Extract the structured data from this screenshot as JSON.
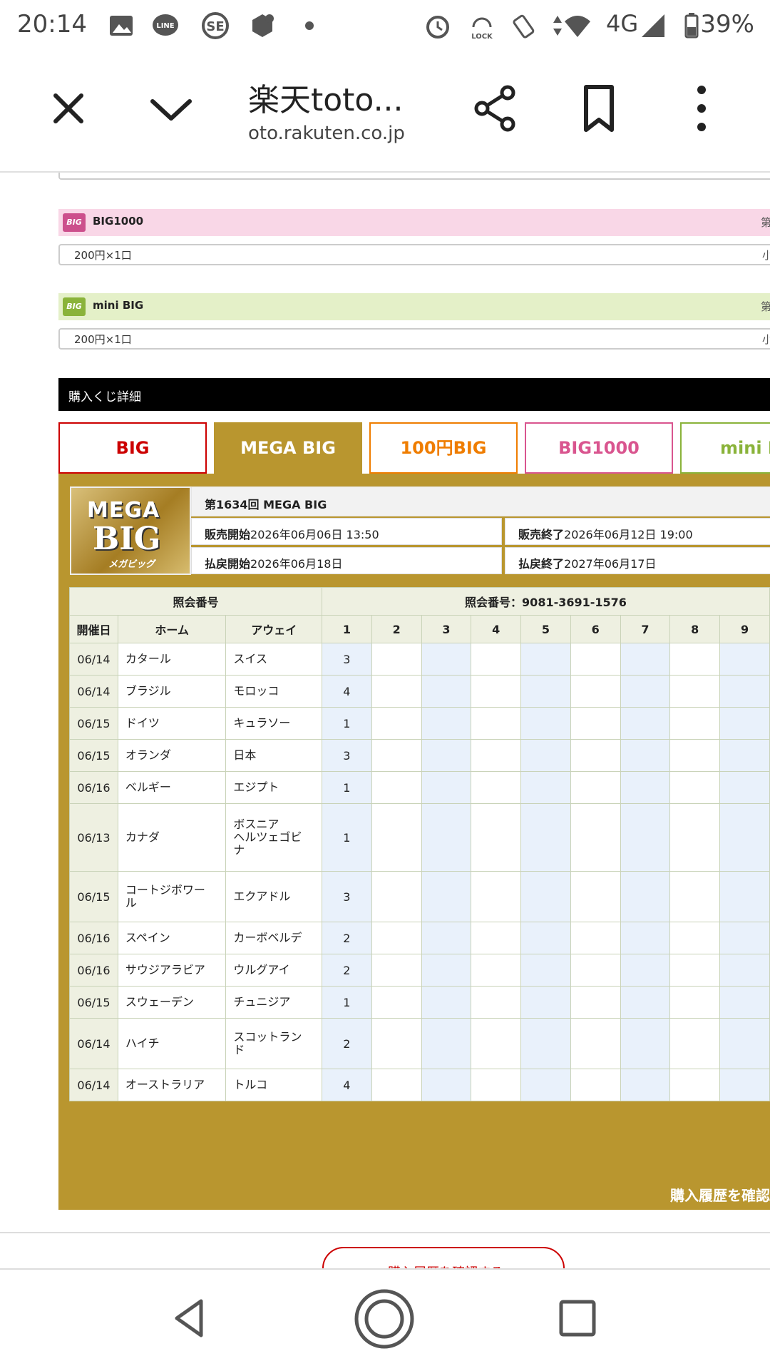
{
  "status_bar": {
    "time": "20:14",
    "network": "4G",
    "battery": "39%",
    "icons": [
      "image-icon",
      "line-icon",
      "sbi-icon",
      "mercari-icon",
      "dot-icon",
      "alarm-icon",
      "lock-icon",
      "vibrate-icon",
      "data-arrows-icon",
      "wifi-icon",
      "signal-icon",
      "battery-icon"
    ]
  },
  "toolbar": {
    "title": "楽天toto...",
    "url": "oto.rakuten.co.jp"
  },
  "lotteries": [
    {
      "name": "BIG1000",
      "price": "200円×1口",
      "color": "#f9d7e7",
      "badge_color": "#cc4f8c",
      "right_char": "第",
      "price_right": "小"
    },
    {
      "name": "mini BIG",
      "price": "200円×1口",
      "color": "#e4f0c8",
      "badge_color": "#8ab33a",
      "right_char": "第",
      "price_right": "小"
    }
  ],
  "badge_text": "BIG",
  "detail_header": "購入くじ詳細",
  "tabs": [
    {
      "label": "BIG",
      "color": "#cc0000",
      "active": false
    },
    {
      "label": "MEGA BIG",
      "color": "#b9962f",
      "active": true
    },
    {
      "label": "100円BIG",
      "color": "#ef7d00",
      "active": false
    },
    {
      "label": "BIG1000",
      "color": "#d9558f",
      "active": false
    },
    {
      "label": "mini BIG",
      "color": "#8ab33a",
      "active": false
    }
  ],
  "logo": {
    "line1": "MEGA",
    "line2": "BIG",
    "line3": "メガビッグ"
  },
  "draw": {
    "title": "第1634回 MEGA BIG",
    "sale_start_label": "販売開始",
    "sale_start": "2026年06月06日 13:50",
    "sale_end_label": "販売終了",
    "sale_end": "2026年06月12日 19:00",
    "refund_start_label": "払戻開始",
    "refund_start": "2026年06月18日",
    "refund_end_label": "払戻終了",
    "refund_end": "2027年06月17日"
  },
  "table": {
    "ref_header": "照会番号",
    "ref_number": "照会番号：9081-3691-1576",
    "col_date": "開催日",
    "col_home": "ホーム",
    "col_away": "アウェイ",
    "cols": [
      "1",
      "2",
      "3",
      "4",
      "5",
      "6",
      "7",
      "8",
      "9"
    ],
    "rows": [
      {
        "date": "06/14",
        "home": "カタール",
        "away": "スイス",
        "v": "3"
      },
      {
        "date": "06/14",
        "home": "ブラジル",
        "away": "モロッコ",
        "v": "4"
      },
      {
        "date": "06/15",
        "home": "ドイツ",
        "away": "キュラソー",
        "v": "1"
      },
      {
        "date": "06/15",
        "home": "オランダ",
        "away": "日本",
        "v": "3"
      },
      {
        "date": "06/16",
        "home": "ベルギー",
        "away": "エジプト",
        "v": "1"
      },
      {
        "date": "06/13",
        "home": "カナダ",
        "away": "ボスニア\nヘルツェゴビ\nナ",
        "v": "1"
      },
      {
        "date": "06/15",
        "home": "コートジボワー\nル",
        "away": "エクアドル",
        "v": "3"
      },
      {
        "date": "06/16",
        "home": "スペイン",
        "away": "カーボベルデ",
        "v": "2"
      },
      {
        "date": "06/16",
        "home": "サウジアラビア",
        "away": "ウルグアイ",
        "v": "2"
      },
      {
        "date": "06/15",
        "home": "スウェーデン",
        "away": "チュニジア",
        "v": "1"
      },
      {
        "date": "06/14",
        "home": "ハイチ",
        "away": "スコットラン\nド",
        "v": "2"
      },
      {
        "date": "06/14",
        "home": "オーストラリア",
        "away": "トルコ",
        "v": "4"
      }
    ]
  },
  "confirm_link": "購入履歴を確認",
  "confirm_button": "購入履歴を確認する"
}
